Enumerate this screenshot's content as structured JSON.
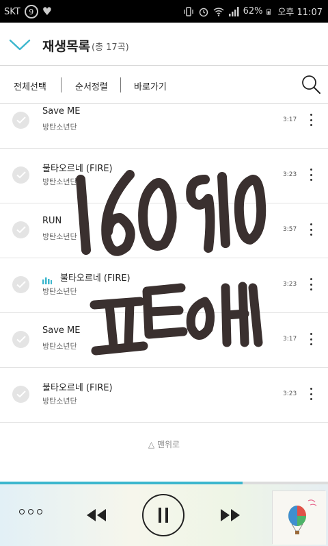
{
  "status_bar": {
    "carrier": "SKT",
    "circle_badge": "9",
    "battery": "62%",
    "time": "오후 11:07",
    "icons": [
      "vibrate-icon",
      "alarm-icon",
      "wifi-icon",
      "signal-icon",
      "battery-icon",
      "heart-icon"
    ]
  },
  "header": {
    "title": "재생목록",
    "count": "(총 17곡)"
  },
  "toolbar": {
    "select_all": "전체선택",
    "sort": "순서정렬",
    "shortcut": "바로가기"
  },
  "tracks": [
    {
      "title": "Save ME",
      "artist": "방탄소년단",
      "duration": "3:17",
      "playing": false
    },
    {
      "title": "불타오르네 (FIRE)",
      "artist": "방탄소년단",
      "duration": "3:23",
      "playing": false
    },
    {
      "title": "RUN",
      "artist": "방탄소년단",
      "duration": "3:57",
      "playing": false
    },
    {
      "title": "불타오르네 (FIRE)",
      "artist": "방탄소년단",
      "duration": "3:23",
      "playing": true
    },
    {
      "title": "Save ME",
      "artist": "방탄소년단",
      "duration": "3:17",
      "playing": false
    },
    {
      "title": "불타오르네 (FIRE)",
      "artist": "방탄소년단",
      "duration": "3:23",
      "playing": false
    }
  ],
  "back_to_top": "△ 맨위로",
  "player": {
    "progress": 0.74
  },
  "overlay_handwriting": {
    "line1": "160910",
    "line2": "표ㄷ아ㅐ"
  },
  "colors": {
    "accent": "#3cb7ce",
    "handwriting": "#3a302f"
  }
}
